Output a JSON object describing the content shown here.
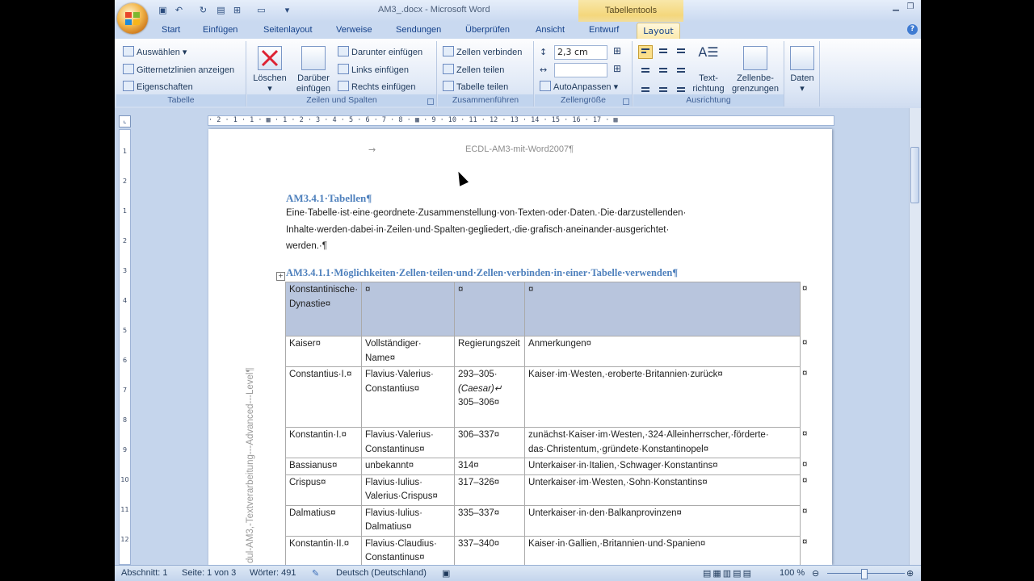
{
  "window": {
    "title": "AM3_.docx - Microsoft Word",
    "context_tab_group": "Tabellentools"
  },
  "tabs": [
    "Start",
    "Einfügen",
    "Seitenlayout",
    "Verweise",
    "Sendungen",
    "Überprüfen",
    "Ansicht",
    "Entwurf",
    "Layout"
  ],
  "ribbon": {
    "tabelle": {
      "label": "Tabelle",
      "auswaehlen": "Auswählen",
      "gitternetz": "Gitternetzlinien anzeigen",
      "eigenschaften": "Eigenschaften"
    },
    "zeilen_spalten": {
      "label": "Zeilen und Spalten",
      "loeschen": "Löschen",
      "darueber_1": "Darüber",
      "darueber_2": "einfügen",
      "darunter": "Darunter einfügen",
      "links": "Links einfügen",
      "rechts": "Rechts einfügen"
    },
    "zusammenfuehren": {
      "label": "Zusammenführen",
      "verbinden": "Zellen verbinden",
      "teilen": "Zellen teilen",
      "tabelle_teilen": "Tabelle teilen"
    },
    "zellengroesse": {
      "label": "Zellengröße",
      "height_value": "2,3 cm",
      "width_value": "",
      "autoanpassen": "AutoAnpassen"
    },
    "ausrichtung": {
      "label": "Ausrichtung",
      "textrichtung_1": "Text-",
      "textrichtung_2": "richtung",
      "zellenbegrenzungen_1": "Zellenbe-",
      "zellenbegrenzungen_2": "grenzungen"
    },
    "daten": {
      "label": "Daten"
    }
  },
  "ruler_text": "· 2 · 1 · 1 · ▦ · 1 · 2 · 3 · 4 · 5 · 6 · 7 · 8 · ▦ · 9 · 10 · 11 · 12 · 13 · 14 · 15 · 16 · 17 · ▦",
  "vertical_ruler": [
    "1",
    "2",
    "1",
    "2",
    "3",
    "4",
    "5",
    "6",
    "7",
    "8",
    "9",
    "10",
    "11",
    "12"
  ],
  "document": {
    "header": "ECDL-AM3-mit-Word2007¶",
    "header_arrow": "→",
    "heading1": "AM3.4.1·Tabellen¶",
    "para_lines": [
      "Eine·Tabelle·ist·eine·geordnete·Zusammenstellung·von·Texten·oder·Daten.·Die·darzustellenden·",
      "Inhalte·werden·dabei·in·Zeilen·und·Spalten·gegliedert,·die·grafisch·aneinander·ausgerichtet·",
      "werden.·¶"
    ],
    "heading2": "AM3.4.1.1·Möglichkeiten·Zellen·teilen·und·Zellen·verbinden·in·einer·Tabelle·verwenden¶",
    "side_text": "dul-AM3,-Textverarbeitung---Advanced---Level¶",
    "table_title_rows": [
      [
        "Konstantinische·",
        "Dynastie¤"
      ],
      [
        "¤"
      ],
      [
        "¤"
      ],
      [
        "¤"
      ]
    ],
    "table_rows": [
      [
        [
          "Kaiser¤"
        ],
        [
          "Vollständiger·",
          "Name¤"
        ],
        [
          "Regierungszeit"
        ],
        [
          "Anmerkungen¤"
        ]
      ],
      [
        [
          "Constantius·I.¤"
        ],
        [
          "Flavius·Valerius·",
          "Constantius¤"
        ],
        [
          "293–305·",
          "(Caesar)↵",
          "305–306¤"
        ],
        [
          "Kaiser·im·Westen,·eroberte·Britannien·zurück¤"
        ]
      ],
      [
        [
          "Konstantin·I.¤"
        ],
        [
          "Flavius·Valerius·",
          "Constantinus¤"
        ],
        [
          "306–337¤"
        ],
        [
          "zunächst·Kaiser·im·Westen,·324·Alleinherrscher,·förderte·",
          "das·Christentum,·gründete·Konstantinopel¤"
        ]
      ],
      [
        [
          "Bassianus¤"
        ],
        [
          "unbekannt¤"
        ],
        [
          "314¤"
        ],
        [
          "Unterkaiser·in·Italien,·Schwager·Konstantins¤"
        ]
      ],
      [
        [
          "Crispus¤"
        ],
        [
          "Flavius·Iulius·",
          "Valerius·Crispus¤"
        ],
        [
          "317–326¤"
        ],
        [
          "Unterkaiser·im·Westen,·Sohn·Konstantins¤"
        ]
      ],
      [
        [
          "Dalmatius¤"
        ],
        [
          "Flavius·Iulius·",
          "Dalmatius¤"
        ],
        [
          "335–337¤"
        ],
        [
          "Unterkaiser·in·den·Balkanprovinzen¤"
        ]
      ],
      [
        [
          "Konstantin·II.¤"
        ],
        [
          "Flavius·Claudius·",
          "Constantinus¤"
        ],
        [
          "337–340¤"
        ],
        [
          "Kaiser·in·Gallien,·Britannien·und·Spanien¤"
        ]
      ]
    ],
    "row_end_mark": "¤"
  },
  "status": {
    "abschnitt": "Abschnitt: 1",
    "seite": "Seite: 1 von 3",
    "woerter": "Wörter: 491",
    "sprache": "Deutsch (Deutschland)",
    "zoom": "100 %"
  }
}
